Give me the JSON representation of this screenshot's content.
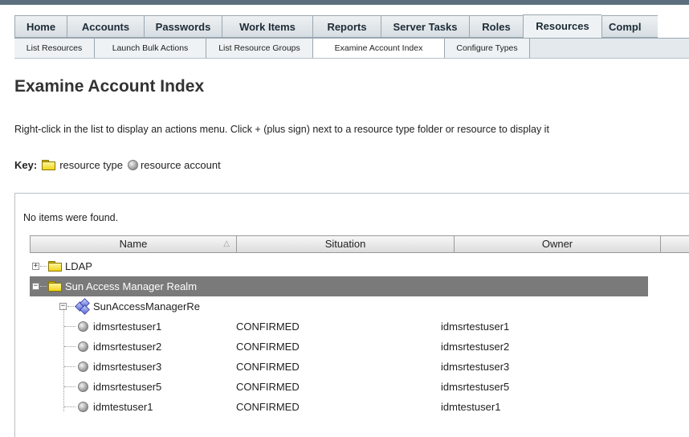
{
  "primary_tabs": [
    {
      "label": "Home",
      "width": 65
    },
    {
      "label": "Accounts",
      "width": 96
    },
    {
      "label": "Passwords",
      "width": 97
    },
    {
      "label": "Work Items",
      "width": 113
    },
    {
      "label": "Reports",
      "width": 85
    },
    {
      "label": "Server Tasks",
      "width": 110
    },
    {
      "label": "Roles",
      "width": 67
    },
    {
      "label": "Resources",
      "width": 98,
      "active": true
    },
    {
      "label": "Compl",
      "width": 70
    }
  ],
  "secondary_tabs": [
    {
      "label": "List Resources",
      "width": 100
    },
    {
      "label": "Launch Bulk Actions",
      "width": 139
    },
    {
      "label": "List Resource Groups",
      "width": 133
    },
    {
      "label": "Examine Account Index",
      "width": 164,
      "active": true
    },
    {
      "label": "Configure Types",
      "width": 106
    }
  ],
  "page": {
    "title": "Examine Account Index",
    "instructions": "Right-click in the list to display an actions menu. Click + (plus sign) next to a resource type folder or resource to display it",
    "key_label": "Key:",
    "key_resource_type": "resource type",
    "key_resource_account": "resource account"
  },
  "panel": {
    "no_items": "No items were found."
  },
  "grid": {
    "columns": {
      "name": "Name",
      "situation": "Situation",
      "owner": "Owner"
    },
    "rows": {
      "ldap": {
        "name": "LDAP"
      },
      "sun_realm": {
        "name": "Sun Access Manager Realm"
      },
      "sun_resource": {
        "name": "SunAccessManagerRe"
      },
      "accounts": [
        {
          "name": "idmsrtestuser1",
          "situation": "CONFIRMED",
          "owner": "idmsrtestuser1"
        },
        {
          "name": "idmsrtestuser2",
          "situation": "CONFIRMED",
          "owner": "idmsrtestuser2"
        },
        {
          "name": "idmsrtestuser3",
          "situation": "CONFIRMED",
          "owner": "idmsrtestuser3"
        },
        {
          "name": "idmsrtestuser5",
          "situation": "CONFIRMED",
          "owner": "idmsrtestuser5"
        },
        {
          "name": "idmtestuser1",
          "situation": "CONFIRMED",
          "owner": "idmtestuser1"
        }
      ]
    }
  },
  "colors": {
    "selected_row": "#7a7a7a",
    "tab_text": "#1d2b36"
  },
  "icons": {
    "folder": "folder-icon",
    "account": "account-icon",
    "resource": "resource-icon",
    "expand": "plus-icon",
    "collapse": "minus-icon",
    "sort": "sort-triangle-icon"
  }
}
